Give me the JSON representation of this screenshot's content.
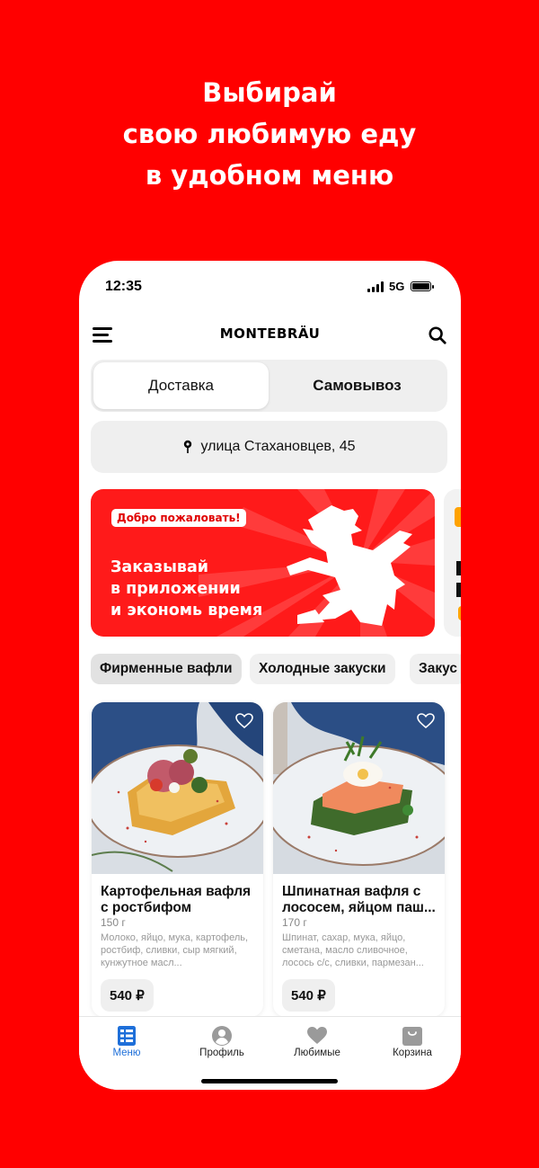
{
  "headline": [
    "Выбирай",
    "свою любимую еду",
    "в удобном меню"
  ],
  "status": {
    "time": "12:35",
    "network": "5G"
  },
  "appbar": {
    "brand": "MONTEBRÄU"
  },
  "delivery_toggle": {
    "options": [
      "Доставка",
      "Самовывоз"
    ],
    "selected": "Доставка"
  },
  "address": "улица Стахановцев, 45",
  "banner": {
    "tag": "Добро пожаловать!",
    "lines": [
      "Заказывай",
      "в приложении",
      "и экономь время"
    ]
  },
  "categories": [
    "Фирменные вафли",
    "Холодные закуски",
    "Закус"
  ],
  "products": [
    {
      "name": "Картофельная вафля с ростбифом",
      "weight": "150 г",
      "description": "Молоко, яйцо, мука, картофель, ростбиф, сливки, сыр мягкий, кунжутное масл...",
      "price": "540 ₽"
    },
    {
      "name": "Шпинатная вафля с лососем, яйцом паш...",
      "weight": "170 г",
      "description": "Шпинат, сахар, мука, яйцо, сметана, масло сливочное, лосось с/с, сливки, пармезан...",
      "price": "540 ₽"
    }
  ],
  "tabbar": [
    {
      "label": "Меню",
      "icon": "menu-list-icon",
      "active": true
    },
    {
      "label": "Профиль",
      "icon": "profile-icon",
      "active": false
    },
    {
      "label": "Любимые",
      "icon": "heart-icon",
      "active": false
    },
    {
      "label": "Корзина",
      "icon": "bag-icon",
      "active": false
    }
  ],
  "colors": {
    "background": "#FF0000",
    "accent_tab": "#1E6FD9",
    "banner": "#FF1A1A"
  }
}
